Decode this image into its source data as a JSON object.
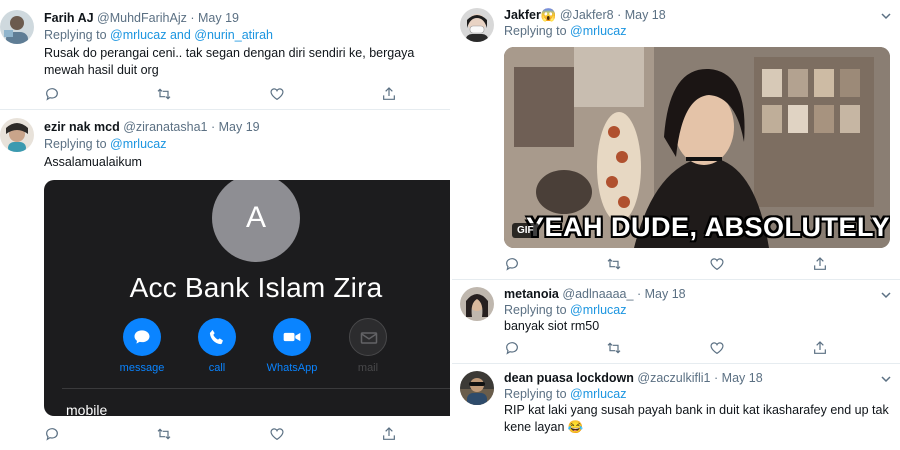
{
  "left_tweets": [
    {
      "name": "Farih AJ",
      "handle": "@MuhdFarihAjz",
      "date": "May 19",
      "replying_label": "Replying to",
      "mentions": "@mrlucaz and @nurin_atirah",
      "text": "Rusak do perangai ceni.. tak segan dengan diri sendiri ke, bergaya mewah hasil duit org"
    },
    {
      "name": "ezir nak mcd",
      "handle": "@ziranatasha1",
      "date": "May 19",
      "replying_label": "Replying to",
      "mentions": "@mrlucaz",
      "text": "Assalamualaikum",
      "phone_card": {
        "avatar_letter": "A",
        "contact_name": "Acc Bank Islam Zira",
        "buttons": [
          {
            "label": "message",
            "icon": "message-bubble-icon",
            "color": "#0a84ff"
          },
          {
            "label": "call",
            "icon": "phone-icon",
            "color": "#0a84ff"
          },
          {
            "label": "WhatsApp",
            "icon": "video-camera-icon",
            "color": "#0a84ff"
          },
          {
            "label": "mail",
            "icon": "mail-icon",
            "color": "#3a3a3c"
          }
        ],
        "mobile_label": "mobile"
      }
    }
  ],
  "right_tweets": [
    {
      "name": "Jakfer😱",
      "handle": "@Jakfer8",
      "date": "May 18",
      "replying_label": "Replying to",
      "mentions": "@mrlucaz",
      "gif": {
        "caption": "YEAH DUDE, ABSOLUTELY!",
        "badge": "GIF"
      }
    },
    {
      "name": "metanoia",
      "handle": "@adlnaaaa_",
      "date": "May 18",
      "replying_label": "Replying to",
      "mentions": "@mrlucaz",
      "text": "banyak siot rm50"
    },
    {
      "name": "dean puasa lockdown",
      "handle": "@zaczulkifli1",
      "date": "May 18",
      "replying_label": "Replying to",
      "mentions": "@mrlucaz",
      "text": "RIP kat laki yang susah payah bank in duit kat ikasharafey end up tak kene layan 😂"
    }
  ],
  "colors": {
    "link": "#1b95e0",
    "muted": "#5b7083",
    "separator": "#e6ecf0"
  }
}
